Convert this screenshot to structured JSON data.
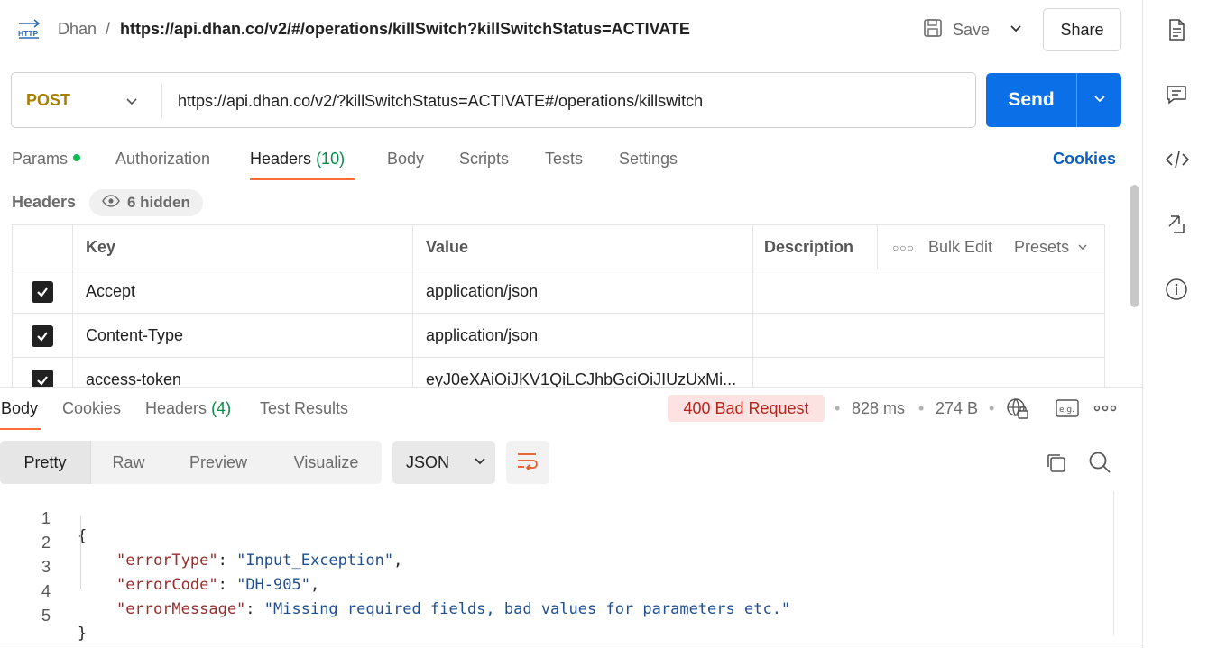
{
  "header": {
    "collection": "Dhan",
    "separator": "/",
    "request_title": "https://api.dhan.co/v2/#/operations/killSwitch?killSwitchStatus=ACTIVATE",
    "save_label": "Save",
    "share_label": "Share"
  },
  "request": {
    "method": "POST",
    "url": "https://api.dhan.co/v2/?killSwitchStatus=ACTIVATE#/operations/killswitch",
    "send_label": "Send",
    "method_color": "#a97f00",
    "send_color": "#0b6fe8"
  },
  "request_tabs": {
    "params": "Params",
    "authorization": "Authorization",
    "headers": "Headers",
    "headers_count": "(10)",
    "body": "Body",
    "scripts": "Scripts",
    "tests": "Tests",
    "settings": "Settings",
    "cookies": "Cookies",
    "active": "Headers"
  },
  "headers_section": {
    "label": "Headers",
    "hidden_label": "6 hidden",
    "columns": {
      "key": "Key",
      "value": "Value",
      "description": "Description",
      "bulk_edit": "Bulk Edit",
      "presets": "Presets"
    },
    "rows": [
      {
        "checked": true,
        "key": "Accept",
        "value": "application/json",
        "description": ""
      },
      {
        "checked": true,
        "key": "Content-Type",
        "value": "application/json",
        "description": ""
      },
      {
        "checked": true,
        "key": "access-token",
        "value": "eyJ0eXAiOiJKV1QiLCJhbGciOiJIUzUxMi...",
        "description": ""
      }
    ]
  },
  "response_tabs": {
    "body": "Body",
    "cookies": "Cookies",
    "headers": "Headers",
    "headers_count": "(4)",
    "test_results": "Test Results",
    "active": "Body"
  },
  "response_meta": {
    "status": "400 Bad Request",
    "time": "828 ms",
    "size": "274 B"
  },
  "response_toolbar": {
    "views": [
      "Pretty",
      "Raw",
      "Preview",
      "Visualize"
    ],
    "active_view": "Pretty",
    "format": "JSON"
  },
  "response_body": {
    "line_numbers": [
      "1",
      "2",
      "3",
      "4",
      "5"
    ],
    "open_brace": "{",
    "close_brace": "}",
    "fields": [
      {
        "key": "\"errorType\"",
        "value": "\"Input_Exception\"",
        "comma": ","
      },
      {
        "key": "\"errorCode\"",
        "value": "\"DH-905\"",
        "comma": ","
      },
      {
        "key": "\"errorMessage\"",
        "value": "\"Missing required fields, bad values for parameters etc.\"",
        "comma": ""
      }
    ]
  },
  "icons": {
    "http": "http-request-icon",
    "save": "save-disk-icon",
    "rail": [
      "document-icon",
      "comment-icon",
      "code-icon",
      "related-collections-icon",
      "info-icon"
    ]
  }
}
